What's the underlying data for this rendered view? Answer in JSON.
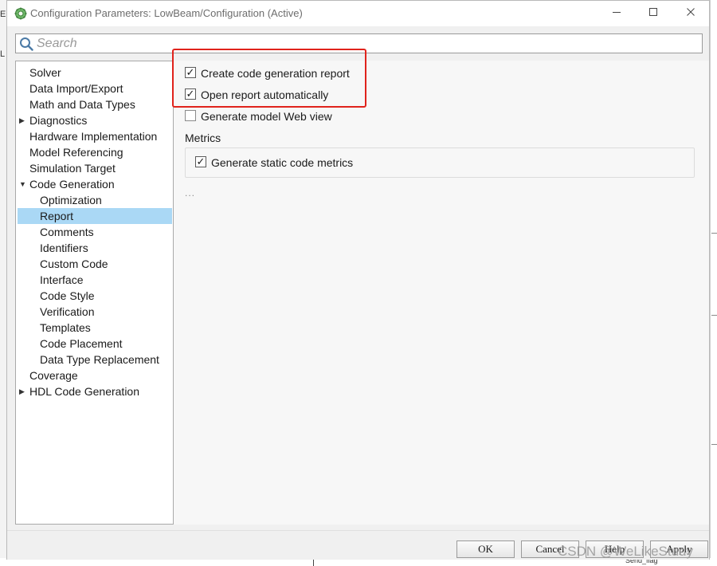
{
  "window": {
    "title": "Configuration Parameters: LowBeam/Configuration (Active)",
    "controls": [
      "minimize",
      "maximize",
      "close"
    ]
  },
  "search": {
    "placeholder": "Search",
    "value": ""
  },
  "nav_tree": {
    "selected": "Report",
    "items": [
      {
        "label": "Solver",
        "level": 0,
        "expandable": false
      },
      {
        "label": "Data Import/Export",
        "level": 0,
        "expandable": false
      },
      {
        "label": "Math and Data Types",
        "level": 0,
        "expandable": false
      },
      {
        "label": "Diagnostics",
        "level": 0,
        "expandable": true,
        "expanded": false
      },
      {
        "label": "Hardware Implementation",
        "level": 0,
        "expandable": false
      },
      {
        "label": "Model Referencing",
        "level": 0,
        "expandable": false
      },
      {
        "label": "Simulation Target",
        "level": 0,
        "expandable": false
      },
      {
        "label": "Code Generation",
        "level": 0,
        "expandable": true,
        "expanded": true
      },
      {
        "label": "Optimization",
        "level": 1,
        "expandable": false
      },
      {
        "label": "Report",
        "level": 1,
        "expandable": false
      },
      {
        "label": "Comments",
        "level": 1,
        "expandable": false
      },
      {
        "label": "Identifiers",
        "level": 1,
        "expandable": false
      },
      {
        "label": "Custom Code",
        "level": 1,
        "expandable": false
      },
      {
        "label": "Interface",
        "level": 1,
        "expandable": false
      },
      {
        "label": "Code Style",
        "level": 1,
        "expandable": false
      },
      {
        "label": "Verification",
        "level": 1,
        "expandable": false
      },
      {
        "label": "Templates",
        "level": 1,
        "expandable": false
      },
      {
        "label": "Code Placement",
        "level": 1,
        "expandable": false
      },
      {
        "label": "Data Type Replacement",
        "level": 1,
        "expandable": false
      },
      {
        "label": "Coverage",
        "level": 0,
        "expandable": false
      },
      {
        "label": "HDL Code Generation",
        "level": 0,
        "expandable": true,
        "expanded": false
      }
    ]
  },
  "report_panel": {
    "options": [
      {
        "label": "Create code generation report",
        "checked": true
      },
      {
        "label": "Open report automatically",
        "checked": true
      },
      {
        "label": "Generate model Web view",
        "checked": false
      }
    ],
    "metrics": {
      "title": "Metrics",
      "options": [
        {
          "label": "Generate static code metrics",
          "checked": true
        }
      ]
    },
    "more": "..."
  },
  "footer": {
    "ok_label": "OK",
    "cancel_label": "Cancel",
    "help_label": "Help",
    "apply_label": "Apply"
  },
  "background": {
    "fragment_text": "Send_flag",
    "letters": [
      "E",
      "L"
    ]
  },
  "watermark": "CSDN @WeLikeStudy",
  "colors": {
    "selection": "#aad8f5",
    "highlight_box": "#e0231c",
    "dialog_bg": "#f0f0f0"
  }
}
